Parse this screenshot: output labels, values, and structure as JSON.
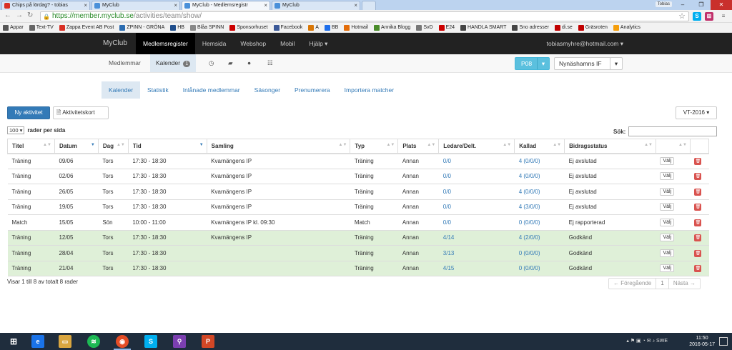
{
  "browser": {
    "tabs": [
      {
        "title": "Chips på lördag? - tobias",
        "color": "#d93025"
      },
      {
        "title": "MyClub",
        "color": "#4a90d9"
      },
      {
        "title": "MyClub - Medlemsregistr",
        "color": "#4a90d9"
      },
      {
        "title": "MyClub",
        "color": "#4a90d9"
      }
    ],
    "profile_name": "Tobias",
    "url_host": "https://member.myclub.se",
    "url_path": "/activities/team/show/",
    "bookmarks": [
      {
        "label": "Appar",
        "color": "#555"
      },
      {
        "label": "Text-TV",
        "color": "#666"
      },
      {
        "label": "Zappa Event AB Post",
        "color": "#d93025"
      },
      {
        "label": "ZPINN - GRÖNA",
        "color": "#2b6cb0"
      },
      {
        "label": "HB",
        "color": "#1f4e8c"
      },
      {
        "label": "Blåa SPINN",
        "color": "#888"
      },
      {
        "label": "Sponsorhuset",
        "color": "#cc0000"
      },
      {
        "label": "Facebook",
        "color": "#3b5998"
      },
      {
        "label": "A",
        "color": "#d97706"
      },
      {
        "label": "BB",
        "color": "#1f6feb"
      },
      {
        "label": "Hotmail",
        "color": "#e36c09"
      },
      {
        "label": "Annika Blogg",
        "color": "#4a8c2a"
      },
      {
        "label": "SvD",
        "color": "#777"
      },
      {
        "label": "E24",
        "color": "#cc0000"
      },
      {
        "label": "HANDLA SMART",
        "color": "#444"
      },
      {
        "label": "Sno adresser",
        "color": "#444"
      },
      {
        "label": "di.se",
        "color": "#c00000"
      },
      {
        "label": "Gräsroten",
        "color": "#c00000"
      },
      {
        "label": "Analytics",
        "color": "#f59e0b"
      }
    ]
  },
  "navbar": {
    "brand": "MyClub",
    "links": [
      "Medlemsregister",
      "Hemsida",
      "Webshop",
      "Mobil",
      "Hjälp ▾"
    ],
    "user_email": "tobiasmyhre@hotmail.com ▾"
  },
  "subnav": {
    "members": "Medlemmar",
    "calendar": "Kalender",
    "calendar_badge": "1",
    "team_code": "P08",
    "club": "Nynäshamns IF"
  },
  "activity_tabs": [
    "Kalender",
    "Statistik",
    "Inlånade medlemmar",
    "Säsonger",
    "Prenumerera",
    "Importera matcher"
  ],
  "toolbar": {
    "new_activity": "Ny aktivitet",
    "activity_card": "Aktivitetskort",
    "season": "VT-2016 ▾",
    "per_page_value": "100",
    "per_page_label": "rader per sida",
    "search_label": "Sök:"
  },
  "table": {
    "headers": [
      "Titel",
      "Datum",
      "Dag",
      "Tid",
      "Samling",
      "Typ",
      "Plats",
      "Ledare/Delt.",
      "Kallad",
      "Bidragsstatus",
      "",
      ""
    ],
    "rows": [
      {
        "titel": "Träning",
        "datum": "09/06",
        "dag": "Tors",
        "tid": "17:30 - 18:30",
        "samling": "Kvarnängens IP",
        "typ": "Träning",
        "plats": "Annan",
        "ledare": "0/0",
        "kallad": "4 (0/0/0)",
        "status": "Ej avslutad",
        "approved": false
      },
      {
        "titel": "Träning",
        "datum": "02/06",
        "dag": "Tors",
        "tid": "17:30 - 18:30",
        "samling": "Kvarnängens IP",
        "typ": "Träning",
        "plats": "Annan",
        "ledare": "0/0",
        "kallad": "4 (0/0/0)",
        "status": "Ej avslutad",
        "approved": false
      },
      {
        "titel": "Träning",
        "datum": "26/05",
        "dag": "Tors",
        "tid": "17:30 - 18:30",
        "samling": "Kvarnängens IP",
        "typ": "Träning",
        "plats": "Annan",
        "ledare": "0/0",
        "kallad": "4 (0/0/0)",
        "status": "Ej avslutad",
        "approved": false
      },
      {
        "titel": "Träning",
        "datum": "19/05",
        "dag": "Tors",
        "tid": "17:30 - 18:30",
        "samling": "Kvarnängens IP",
        "typ": "Träning",
        "plats": "Annan",
        "ledare": "0/0",
        "kallad": "4 (3/0/0)",
        "status": "Ej avslutad",
        "approved": false
      },
      {
        "titel": "Match",
        "datum": "15/05",
        "dag": "Sön",
        "tid": "10:00 - 11:00",
        "samling": "Kvarnängens IP kl. 09:30",
        "typ": "Match",
        "plats": "Annan",
        "ledare": "0/0",
        "kallad": "0 (0/0/0)",
        "status": "Ej rapporterad",
        "approved": false
      },
      {
        "titel": "Träning",
        "datum": "12/05",
        "dag": "Tors",
        "tid": "17:30 - 18:30",
        "samling": "Kvarnängens IP",
        "typ": "Träning",
        "plats": "Annan",
        "ledare": "4/14",
        "kallad": "4 (2/0/0)",
        "status": "Godkänd",
        "approved": true
      },
      {
        "titel": "Träning",
        "datum": "28/04",
        "dag": "Tors",
        "tid": "17:30 - 18:30",
        "samling": "",
        "typ": "Träning",
        "plats": "Annan",
        "ledare": "3/13",
        "kallad": "0 (0/0/0)",
        "status": "Godkänd",
        "approved": true
      },
      {
        "titel": "Träning",
        "datum": "21/04",
        "dag": "Tors",
        "tid": "17:30 - 18:30",
        "samling": "",
        "typ": "Träning",
        "plats": "Annan",
        "ledare": "4/15",
        "kallad": "0 (0/0/0)",
        "status": "Godkänd",
        "approved": true
      }
    ],
    "select_label": "Välj"
  },
  "footer": {
    "info": "Visar 1 till 8 av totalt 8 rader",
    "prev": "← Föregående",
    "page": "1",
    "next": "Nästa →"
  },
  "taskbar": {
    "language": "SWE",
    "time": "11:50",
    "date": "2016-05-17"
  }
}
